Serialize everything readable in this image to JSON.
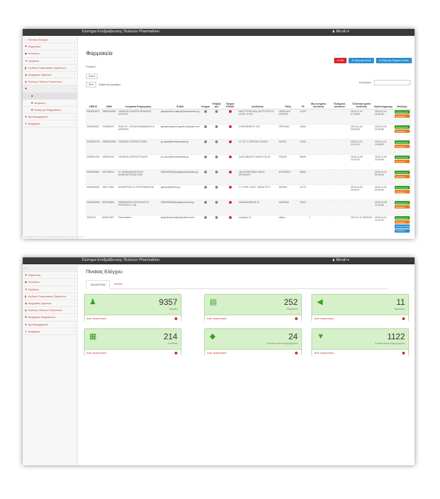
{
  "app_title": "Σύστημα Επιβράβευσης Πελατών Pharmathen",
  "user_menu": "♟ Micrah ▾",
  "sidebar": {
    "items": [
      {
        "label": "Πίνακας Ελέγχου",
        "icon": "home-icon",
        "arrow": ""
      },
      {
        "label": "Κάμπτελες",
        "icon": "flag-icon",
        "arrow": "‹"
      },
      {
        "label": "Κουπόνια",
        "icon": "tag-icon",
        "arrow": "‹"
      },
      {
        "label": "Προϊόντα",
        "icon": "cart-icon",
        "arrow": "‹"
      },
      {
        "label": "Κωδικοί Συσκευασίας Προϊόντων",
        "icon": "barcode-icon",
        "arrow": "‹"
      },
      {
        "label": "Διαχείριση Χρηστών",
        "icon": "users-icon",
        "arrow": "‹"
      },
      {
        "label": "Κανόνες Πόντων/ Κουπονιών",
        "icon": "rules-icon",
        "arrow": "‹"
      },
      {
        "label": "Διαχείριση Φαρμακείων",
        "icon": "pharmacy-icon",
        "arrow": "‹"
      },
      {
        "label": "Api Management",
        "icon": "api-icon",
        "arrow": "‹"
      },
      {
        "label": "Διαχείριση",
        "icon": "wrench-icon",
        "arrow": "‹"
      }
    ],
    "subitems": [
      "Φαρμακεία",
      "Αιτήσεις/ς",
      "Εισαγωγή Φαρμακείων"
    ]
  },
  "pharmacies_page": {
    "title": "Φαρμακεία",
    "new_button": "Νέο",
    "excel_button": "Εξαγωγή Λίστας",
    "excel_full_button": "Εξαγωγή Πλήρους Λίστας",
    "actions_label": "Ενέργεια",
    "actions_select": "Όλα ▾",
    "page_size": "25 ▾",
    "show_label": "Εμφάνιση εγγραφών",
    "search_label": "Αναζήτηση:",
    "columns": [
      "CRM ID",
      "ΑΦΜ",
      "Ονομασία Επιχείρησης",
      "E-Mail",
      "Ενεργό",
      "Επιβεβ αιω",
      "Έγκρισ Επιλέθ",
      "Διεύθυνση",
      "Πόλη",
      "ΤΚ",
      "Μη σωτημένα κουπόνια",
      "Πωτημένα κουπόνια",
      "Τελευταία ημ/νία σύνδεσης",
      "Ημ/νία Δημιουργ",
      "Επιλογές"
    ],
    "rows": [
      {
        "crm": "0000000570",
        "afm": "099876208H",
        "name": "HONDOS CENTER ΗΡΑΚΛΕΙΟ ΚΡΗΤΗΣ",
        "email": "yawjdoctrlos.caktlu@hondoscenter.gr",
        "addr": "ΜΑΡΤΥΡΩΝ 25ης ΑΥΓΟΥΣΤΟΥ & ΑΓΙΟΥ ΤΙΤΟΥ",
        "city": "ΗΡΑΚΛΕΙΟ ΚΡΗΤΗΣ",
        "tk": "71202",
        "unused": "-",
        "used": "-",
        "last": "2016-12-12 07:45:53",
        "created": "2016-12-01 10:53:30",
        "btns": [
          "Επεξεργασία",
          "Διαγραφή"
        ]
      },
      {
        "crm": "0000000627",
        "afm": "000450209",
        "name": "ΖΗΝ Ε.Ε. / ΜΠΑΛΤΑΣΑΒΑΝΔΟΥ Α. ΜΟΡΦΗΣ",
        "email": "georgekapsoulou.gialla.1@gmail.com",
        "addr": "ΚΛΕΟΜΕΝΟΥΣ 192",
        "city": "ΠΕΡΑΚΑΣ",
        "tk": "15344",
        "unused": "-",
        "used": "-",
        "last": "2016-11-16 09:53:59",
        "created": "2016-10-31 09:35:36",
        "btns": [
          "Επεξεργασία",
          "Διαγραφή"
        ]
      },
      {
        "crm": "0000000739",
        "afm": "099876209N",
        "name": "HONDOS CENTER ΣΠΑΤΑ",
        "email": "yo.spata@hondoscenter.gr",
        "addr": "Ο.Τ.E.Τ.2 ΠΕΡΟΧΗ ΓΙΑΛΟΥ",
        "city": "ΣΠΑΤΑ",
        "tk": "71202",
        "unused": "-",
        "used": "-",
        "last": "2016-12-01 11:15:12",
        "created": "2016-10-31 10:58:03",
        "btns": [
          "Επεξεργασία",
          "Διαγραφή"
        ]
      },
      {
        "crm": "0000000750",
        "afm": "099876209",
        "name": "HONDOS CENTER ΡΟΔΟΣ",
        "email": "yo.rodos@hondoscenter.gr",
        "addr": "ΑΛΕΞΑΝΔΡΟΥ ΔΙΑΚΟΥ 30-32",
        "city": "ΡΟΔΟΣ",
        "tk": "85100",
        "unused": "-",
        "used": "-",
        "last": "2016-12-06 14:18:29",
        "created": "2016-12-05 10:49:06",
        "btns": [
          "Επεξεργασία",
          "Διαγραφή"
        ]
      },
      {
        "crm": "0000000801",
        "afm": "097725012",
        "name": "Ν. ΠΑΓΑΝΑΚΟΠΟΥΛΟΥ ΜΟΝΟΠΡΟΣΩΠΗ ΕΠΕ",
        "email": "0000000801@loyalty.pharmathen.gr",
        "addr": "ΝΕΑ ΕΠΑΡΧΙΑΚΗ ΟΔΟΣ ΜΥΚΟΝΟΥ",
        "city": "ΜΥΚΟΝΟΣ",
        "tk": "84600",
        "unused": "-",
        "used": "-",
        "last": "-",
        "created": "2016-10-31 09:35:18",
        "btns": [
          "Επεξεργασία",
          "Διαγραφή"
        ]
      },
      {
        "crm": "0000000803",
        "afm": "050771484",
        "name": "ΔΗΜΗΤΡΙΟΣ Β. ΝΤΟΓΡΑΜΑΤΖΗΣ",
        "email": "gemma@otenet.gr",
        "addr": "Λ. ΣΤΡΑΤ. ΑΛΕΞ. ΠΑΠΑΓΟΥ 9",
        "city": "ΑΘΗΝΑ",
        "tk": "10773",
        "unused": "-",
        "used": "-",
        "last": "2016-11-03 16:09:07",
        "created": "2016-10-31 09:35:33",
        "btns": [
          "Επεξεργασία",
          "Διαγραφή"
        ]
      },
      {
        "crm": "0000000834",
        "afm": "800749663",
        "name": "ΦΑΡΜΑΚΕΙΟ ΧΡΗΣΤΑΚΟΥ & ΡΟΤΣΚΟΣ Ε. ΟΕ",
        "email": "0000000834@loyalty.nuss.kik.gr",
        "addr": "ΦΚ/ΑΔΕΛΦΕΙΑΣ 41",
        "city": "ΑΧΑΡΝΑΙ",
        "tk": "13673",
        "unused": "-",
        "used": "-",
        "last": "-",
        "created": "2016-09-28 11:03:36",
        "btns": [
          "Επεξεργασία",
          "Διαγραφή"
        ]
      },
      {
        "crm": "3032123",
        "afm": "804321987",
        "name": "Pharmathen",
        "email": "kpapaleandro@pharmathen.com",
        "addr": "ευκαμίδο 12",
        "city": "αθηνα",
        "tk": "",
        "unused": "1",
        "used": "-",
        "last": "2016-11-11 08:25:55",
        "created": "2016-10-10 11:15:29",
        "btns": [
          "Επεξεργασία",
          "Διαγραφή",
          "Αλλαγή Κωδικού",
          "Πωλήσεις"
        ]
      }
    ]
  },
  "dashboard": {
    "title": "Πίνακας Ελέγχου",
    "tabs": [
      "ΒΙΟΘΕΡΜΑ",
      "ΜΟΧΕ"
    ],
    "detail_link": "Δείτε περισσότερα",
    "cards": [
      {
        "value": "9357",
        "label": "Χρήστες",
        "icon": "user-icon"
      },
      {
        "value": "252",
        "label": "Φαρμακεία",
        "icon": "book-icon"
      },
      {
        "value": "11",
        "label": "Καμπάνιες",
        "icon": "megaphone-icon"
      },
      {
        "value": "214",
        "label": "Κουπόνια",
        "icon": "qr-icon"
      },
      {
        "value": "24",
        "label": "Κουπόνια άγινα εξαργυρωμένα",
        "icon": "tag-icon"
      },
      {
        "value": "1122",
        "label": "Κωδικοί άγινα εξαργυρωμένοι",
        "icon": "cart-icon"
      }
    ]
  },
  "footer_text": "Copyright © Pharmathen Loyalty Web System. All rights reserved"
}
